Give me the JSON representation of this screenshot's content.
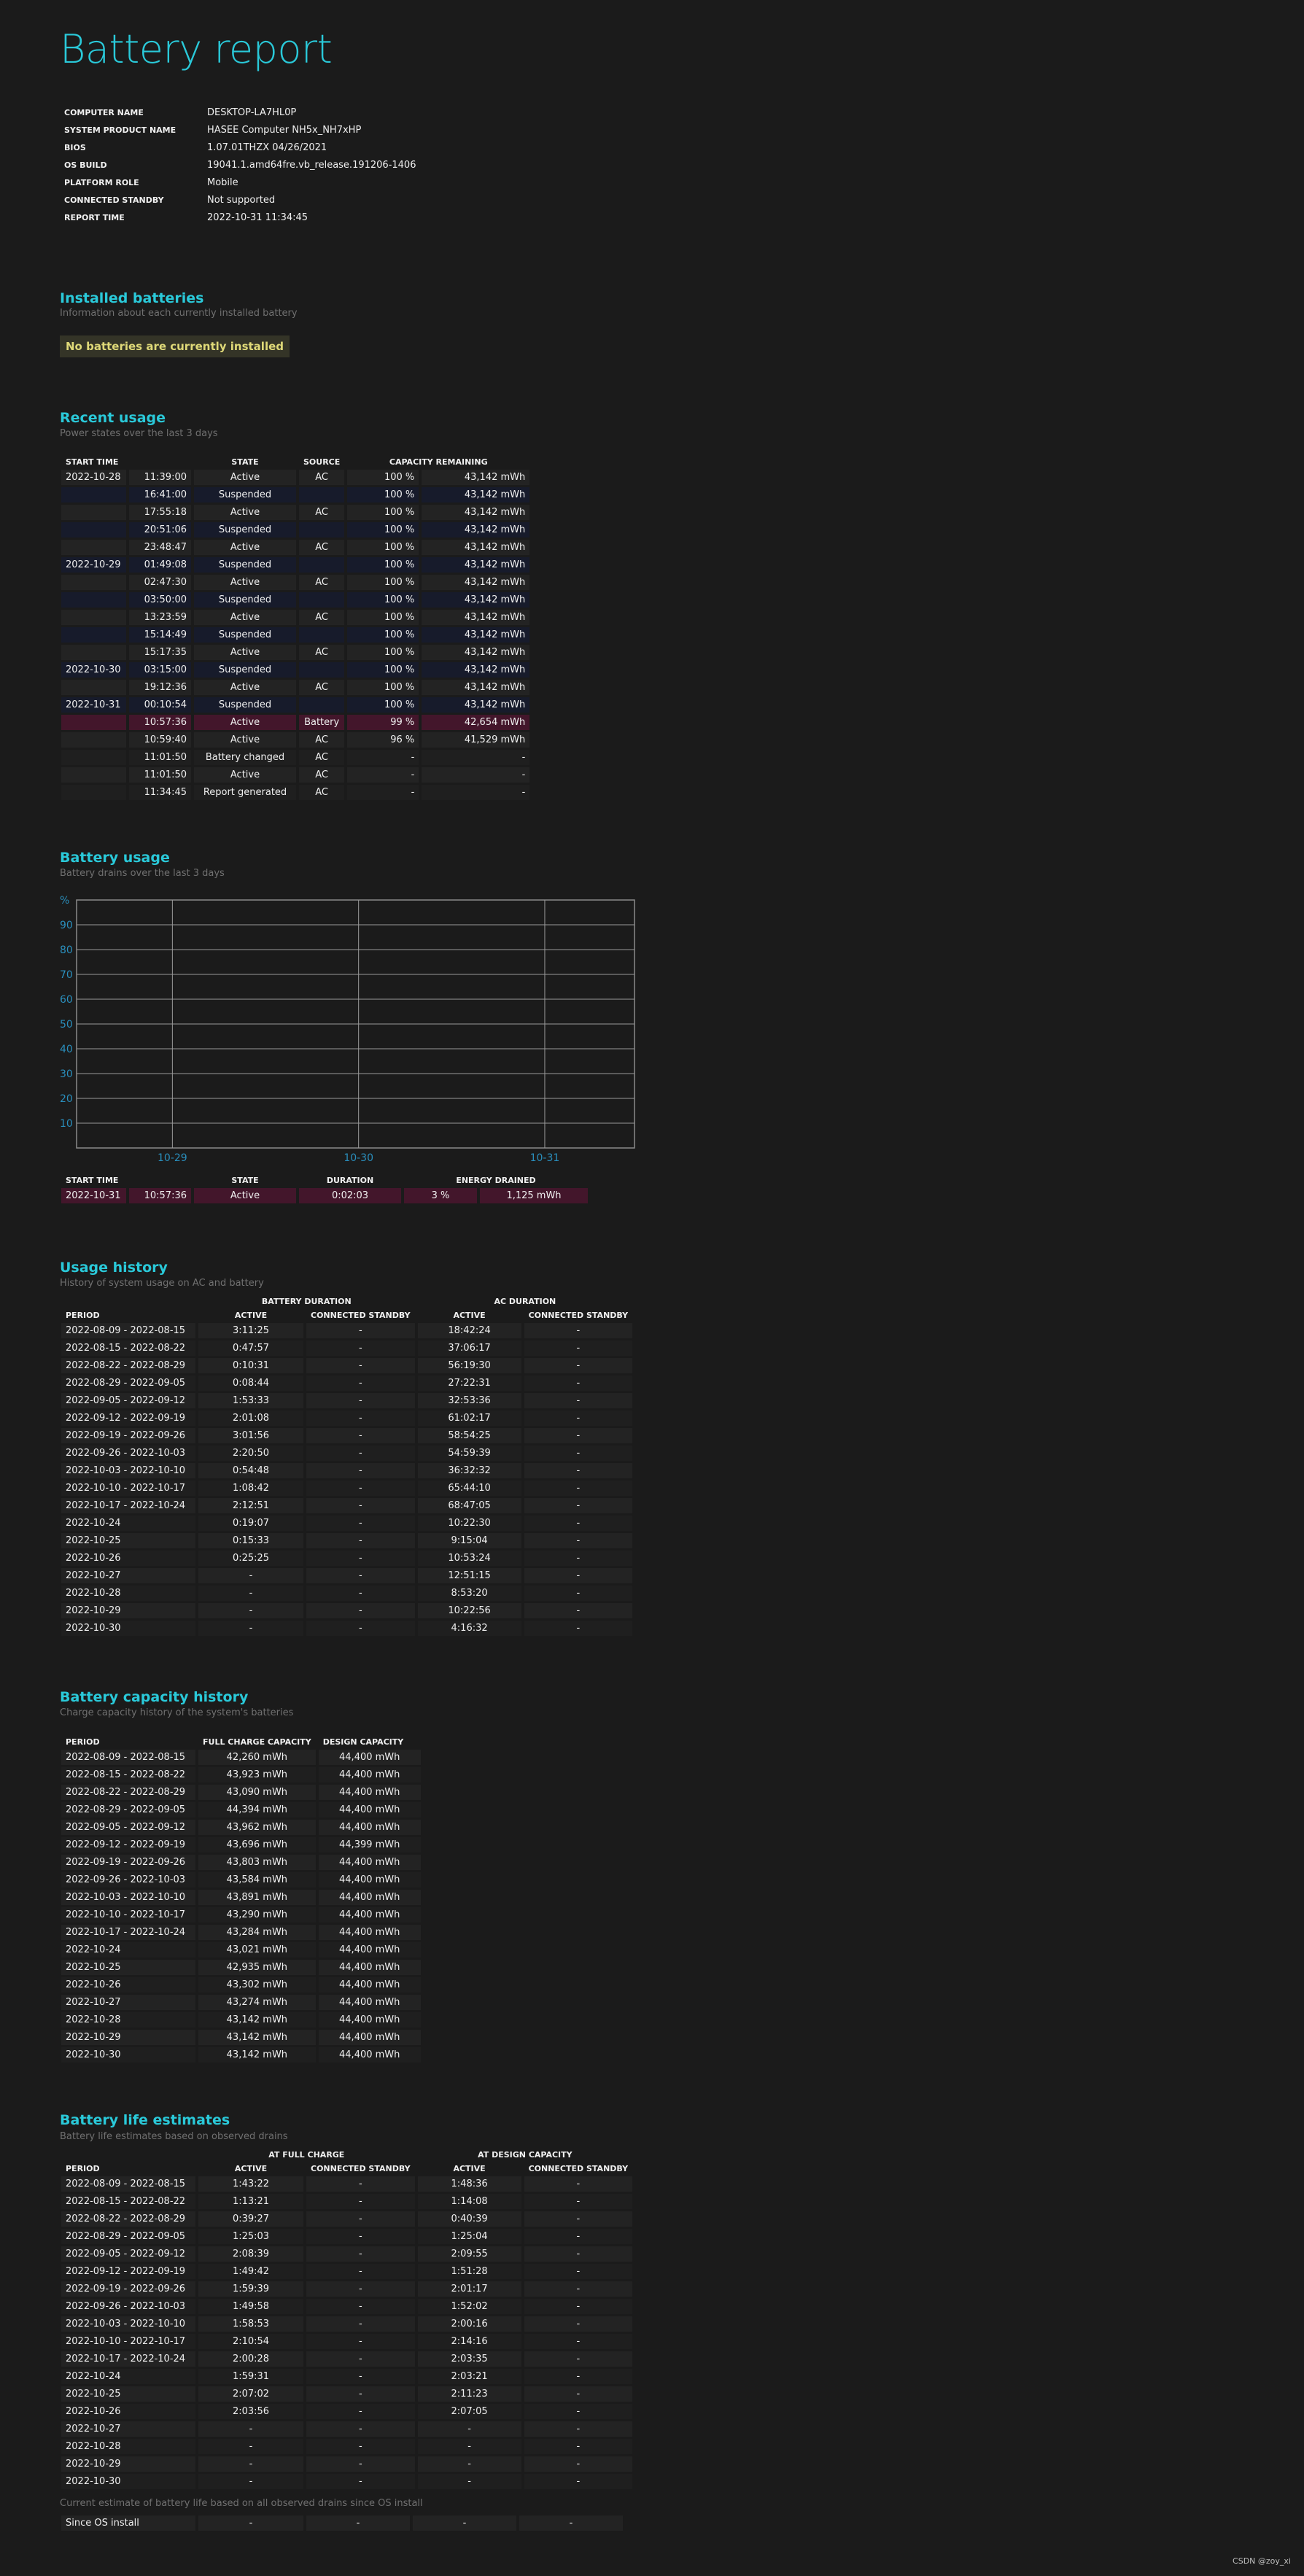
{
  "title": "Battery report",
  "info": [
    {
      "label": "COMPUTER NAME",
      "value": "DESKTOP-LA7HL0P"
    },
    {
      "label": "SYSTEM PRODUCT NAME",
      "value": "HASEE Computer NH5x_NH7xHP"
    },
    {
      "label": "BIOS",
      "value": "1.07.01THZX 04/26/2021"
    },
    {
      "label": "OS BUILD",
      "value": "19041.1.amd64fre.vb_release.191206-1406"
    },
    {
      "label": "PLATFORM ROLE",
      "value": "Mobile"
    },
    {
      "label": "CONNECTED STANDBY",
      "value": "Not supported"
    },
    {
      "label": "REPORT TIME",
      "value": "2022-10-31  11:34:45"
    }
  ],
  "installed": {
    "title": "Installed batteries",
    "subtitle": "Information about each currently installed battery",
    "message": "No batteries are currently installed"
  },
  "recent": {
    "title": "Recent usage",
    "subtitle": "Power states over the last 3 days",
    "headers": [
      "START TIME",
      "STATE",
      "SOURCE",
      "CAPACITY REMAINING"
    ],
    "rows": [
      [
        "2022-10-28",
        "11:39:00",
        "Active",
        "AC",
        "100 %",
        "43,142 mWh"
      ],
      [
        "",
        "16:41:00",
        "Suspended",
        "",
        "100 %",
        "43,142 mWh"
      ],
      [
        "",
        "17:55:18",
        "Active",
        "AC",
        "100 %",
        "43,142 mWh"
      ],
      [
        "",
        "20:51:06",
        "Suspended",
        "",
        "100 %",
        "43,142 mWh"
      ],
      [
        "",
        "23:48:47",
        "Active",
        "AC",
        "100 %",
        "43,142 mWh"
      ],
      [
        "2022-10-29",
        "01:49:08",
        "Suspended",
        "",
        "100 %",
        "43,142 mWh"
      ],
      [
        "",
        "02:47:30",
        "Active",
        "AC",
        "100 %",
        "43,142 mWh"
      ],
      [
        "",
        "03:50:00",
        "Suspended",
        "",
        "100 %",
        "43,142 mWh"
      ],
      [
        "",
        "13:23:59",
        "Active",
        "AC",
        "100 %",
        "43,142 mWh"
      ],
      [
        "",
        "15:14:49",
        "Suspended",
        "",
        "100 %",
        "43,142 mWh"
      ],
      [
        "",
        "15:17:35",
        "Active",
        "AC",
        "100 %",
        "43,142 mWh"
      ],
      [
        "2022-10-30",
        "03:15:00",
        "Suspended",
        "",
        "100 %",
        "43,142 mWh"
      ],
      [
        "",
        "19:12:36",
        "Active",
        "AC",
        "100 %",
        "43,142 mWh"
      ],
      [
        "2022-10-31",
        "00:10:54",
        "Suspended",
        "",
        "100 %",
        "43,142 mWh"
      ],
      [
        "",
        "10:57:36",
        "Active",
        "Battery",
        "99 %",
        "42,654 mWh"
      ],
      [
        "",
        "10:59:40",
        "Active",
        "AC",
        "96 %",
        "41,529 mWh"
      ],
      [
        "",
        "11:01:50",
        "Battery changed",
        "AC",
        "-",
        "-"
      ],
      [
        "",
        "11:01:50",
        "Active",
        "AC",
        "-",
        "-"
      ],
      [
        "",
        "11:34:45",
        "Report generated",
        "AC",
        "-",
        "-"
      ]
    ],
    "row_styles": [
      "even",
      "dim",
      "even",
      "dim",
      "even",
      "dim",
      "even",
      "dim",
      "even",
      "dim",
      "even",
      "dim",
      "even",
      "dim",
      "hl",
      "even",
      "odd",
      "even",
      "odd"
    ]
  },
  "battery_usage": {
    "title": "Battery usage",
    "subtitle": "Battery drains over the last 3 days",
    "chart_data": {
      "type": "line",
      "title": "",
      "xlabel": "",
      "ylabel": "%",
      "ylim": [
        0,
        100
      ],
      "yticks": [
        10,
        20,
        30,
        40,
        50,
        60,
        70,
        80,
        90
      ],
      "xticks": [
        "10-29",
        "10-30",
        "10-31"
      ],
      "grid": true,
      "series": []
    },
    "headers": [
      "START TIME",
      "STATE",
      "DURATION",
      "ENERGY DRAINED"
    ],
    "rows": [
      [
        "2022-10-31",
        "10:57:36",
        "Active",
        "0:02:03",
        "3 %",
        "1,125 mWh"
      ]
    ]
  },
  "usage_history": {
    "title": "Usage history",
    "subtitle": "History of system usage on AC and battery",
    "group1": "BATTERY DURATION",
    "group2": "AC DURATION",
    "headers": [
      "PERIOD",
      "ACTIVE",
      "CONNECTED STANDBY",
      "ACTIVE",
      "CONNECTED STANDBY"
    ],
    "rows": [
      [
        "2022-08-09 - 2022-08-15",
        "3:11:25",
        "-",
        "18:42:24",
        "-"
      ],
      [
        "2022-08-15 - 2022-08-22",
        "0:47:57",
        "-",
        "37:06:17",
        "-"
      ],
      [
        "2022-08-22 - 2022-08-29",
        "0:10:31",
        "-",
        "56:19:30",
        "-"
      ],
      [
        "2022-08-29 - 2022-09-05",
        "0:08:44",
        "-",
        "27:22:31",
        "-"
      ],
      [
        "2022-09-05 - 2022-09-12",
        "1:53:33",
        "-",
        "32:53:36",
        "-"
      ],
      [
        "2022-09-12 - 2022-09-19",
        "2:01:08",
        "-",
        "61:02:17",
        "-"
      ],
      [
        "2022-09-19 - 2022-09-26",
        "3:01:56",
        "-",
        "58:54:25",
        "-"
      ],
      [
        "2022-09-26 - 2022-10-03",
        "2:20:50",
        "-",
        "54:59:39",
        "-"
      ],
      [
        "2022-10-03 - 2022-10-10",
        "0:54:48",
        "-",
        "36:32:32",
        "-"
      ],
      [
        "2022-10-10 - 2022-10-17",
        "1:08:42",
        "-",
        "65:44:10",
        "-"
      ],
      [
        "2022-10-17 - 2022-10-24",
        "2:12:51",
        "-",
        "68:47:05",
        "-"
      ],
      [
        "2022-10-24",
        "0:19:07",
        "-",
        "10:22:30",
        "-"
      ],
      [
        "2022-10-25",
        "0:15:33",
        "-",
        "9:15:04",
        "-"
      ],
      [
        "2022-10-26",
        "0:25:25",
        "-",
        "10:53:24",
        "-"
      ],
      [
        "2022-10-27",
        "-",
        "-",
        "12:51:15",
        "-"
      ],
      [
        "2022-10-28",
        "-",
        "-",
        "8:53:20",
        "-"
      ],
      [
        "2022-10-29",
        "-",
        "-",
        "10:22:56",
        "-"
      ],
      [
        "2022-10-30",
        "-",
        "-",
        "4:16:32",
        "-"
      ]
    ]
  },
  "capacity_history": {
    "title": "Battery capacity history",
    "subtitle": "Charge capacity history of the system's batteries",
    "headers": [
      "PERIOD",
      "FULL CHARGE CAPACITY",
      "DESIGN CAPACITY"
    ],
    "rows": [
      [
        "2022-08-09 - 2022-08-15",
        "42,260 mWh",
        "44,400 mWh"
      ],
      [
        "2022-08-15 - 2022-08-22",
        "43,923 mWh",
        "44,400 mWh"
      ],
      [
        "2022-08-22 - 2022-08-29",
        "43,090 mWh",
        "44,400 mWh"
      ],
      [
        "2022-08-29 - 2022-09-05",
        "44,394 mWh",
        "44,400 mWh"
      ],
      [
        "2022-09-05 - 2022-09-12",
        "43,962 mWh",
        "44,400 mWh"
      ],
      [
        "2022-09-12 - 2022-09-19",
        "43,696 mWh",
        "44,399 mWh"
      ],
      [
        "2022-09-19 - 2022-09-26",
        "43,803 mWh",
        "44,400 mWh"
      ],
      [
        "2022-09-26 - 2022-10-03",
        "43,584 mWh",
        "44,400 mWh"
      ],
      [
        "2022-10-03 - 2022-10-10",
        "43,891 mWh",
        "44,400 mWh"
      ],
      [
        "2022-10-10 - 2022-10-17",
        "43,290 mWh",
        "44,400 mWh"
      ],
      [
        "2022-10-17 - 2022-10-24",
        "43,284 mWh",
        "44,400 mWh"
      ],
      [
        "2022-10-24",
        "43,021 mWh",
        "44,400 mWh"
      ],
      [
        "2022-10-25",
        "42,935 mWh",
        "44,400 mWh"
      ],
      [
        "2022-10-26",
        "43,302 mWh",
        "44,400 mWh"
      ],
      [
        "2022-10-27",
        "43,274 mWh",
        "44,400 mWh"
      ],
      [
        "2022-10-28",
        "43,142 mWh",
        "44,400 mWh"
      ],
      [
        "2022-10-29",
        "43,142 mWh",
        "44,400 mWh"
      ],
      [
        "2022-10-30",
        "43,142 mWh",
        "44,400 mWh"
      ]
    ]
  },
  "life_estimates": {
    "title": "Battery life estimates",
    "subtitle": "Battery life estimates based on observed drains",
    "group1": "AT FULL CHARGE",
    "group2": "AT DESIGN CAPACITY",
    "headers": [
      "PERIOD",
      "ACTIVE",
      "CONNECTED STANDBY",
      "ACTIVE",
      "CONNECTED STANDBY"
    ],
    "rows": [
      [
        "2022-08-09 - 2022-08-15",
        "1:43:22",
        "-",
        "1:48:36",
        "-"
      ],
      [
        "2022-08-15 - 2022-08-22",
        "1:13:21",
        "-",
        "1:14:08",
        "-"
      ],
      [
        "2022-08-22 - 2022-08-29",
        "0:39:27",
        "-",
        "0:40:39",
        "-"
      ],
      [
        "2022-08-29 - 2022-09-05",
        "1:25:03",
        "-",
        "1:25:04",
        "-"
      ],
      [
        "2022-09-05 - 2022-09-12",
        "2:08:39",
        "-",
        "2:09:55",
        "-"
      ],
      [
        "2022-09-12 - 2022-09-19",
        "1:49:42",
        "-",
        "1:51:28",
        "-"
      ],
      [
        "2022-09-19 - 2022-09-26",
        "1:59:39",
        "-",
        "2:01:17",
        "-"
      ],
      [
        "2022-09-26 - 2022-10-03",
        "1:49:58",
        "-",
        "1:52:02",
        "-"
      ],
      [
        "2022-10-03 - 2022-10-10",
        "1:58:53",
        "-",
        "2:00:16",
        "-"
      ],
      [
        "2022-10-10 - 2022-10-17",
        "2:10:54",
        "-",
        "2:14:16",
        "-"
      ],
      [
        "2022-10-17 - 2022-10-24",
        "2:00:28",
        "-",
        "2:03:35",
        "-"
      ],
      [
        "2022-10-24",
        "1:59:31",
        "-",
        "2:03:21",
        "-"
      ],
      [
        "2022-10-25",
        "2:07:02",
        "-",
        "2:11:23",
        "-"
      ],
      [
        "2022-10-26",
        "2:03:56",
        "-",
        "2:07:05",
        "-"
      ],
      [
        "2022-10-27",
        "-",
        "-",
        "-",
        "-"
      ],
      [
        "2022-10-28",
        "-",
        "-",
        "-",
        "-"
      ],
      [
        "2022-10-29",
        "-",
        "-",
        "-",
        "-"
      ],
      [
        "2022-10-30",
        "-",
        "-",
        "-",
        "-"
      ]
    ],
    "note": "Current estimate of battery life based on all observed drains since OS install",
    "since": [
      "Since OS install",
      "-",
      "-",
      "-",
      "-"
    ]
  },
  "footer": "CSDN @zoy_xi"
}
